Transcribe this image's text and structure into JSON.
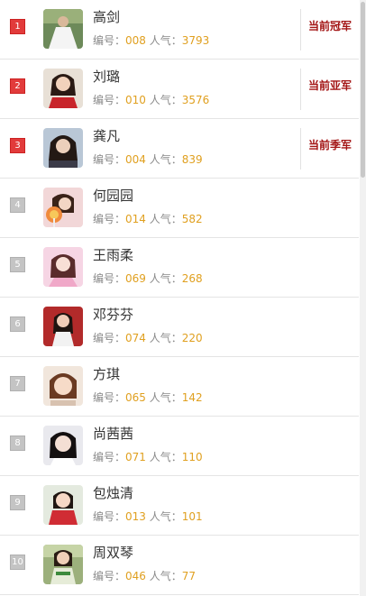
{
  "labels": {
    "id_prefix": "编号：",
    "pop_prefix": "人气："
  },
  "colors": {
    "accent_red": "#e23b3b",
    "badge_red": "#a31515",
    "value_gold": "#e0a020"
  },
  "items": [
    {
      "rank": "1",
      "name": "高剑",
      "id": "008",
      "popularity": "3793",
      "badge": "当前冠军",
      "avatar": "photo-woman-white-dress-outdoor"
    },
    {
      "rank": "2",
      "name": "刘璐",
      "id": "010",
      "popularity": "3576",
      "badge": "当前亚军",
      "avatar": "photo-woman-red-top"
    },
    {
      "rank": "3",
      "name": "龚凡",
      "id": "004",
      "popularity": "839",
      "badge": "当前季军",
      "avatar": "photo-woman-dark-hair"
    },
    {
      "rank": "4",
      "name": "何园园",
      "id": "014",
      "popularity": "582",
      "badge": "",
      "avatar": "photo-woman-lollipop"
    },
    {
      "rank": "5",
      "name": "王雨柔",
      "id": "069",
      "popularity": "268",
      "badge": "",
      "avatar": "photo-woman-pink"
    },
    {
      "rank": "6",
      "name": "邓芬芬",
      "id": "074",
      "popularity": "220",
      "badge": "",
      "avatar": "photo-woman-red-background"
    },
    {
      "rank": "7",
      "name": "方琪",
      "id": "065",
      "popularity": "142",
      "badge": "",
      "avatar": "photo-woman-short-hair"
    },
    {
      "rank": "8",
      "name": "尚茜茜",
      "id": "071",
      "popularity": "110",
      "badge": "",
      "avatar": "photo-woman-white-top"
    },
    {
      "rank": "9",
      "name": "包烛清",
      "id": "013",
      "popularity": "101",
      "badge": "",
      "avatar": "photo-woman-red-dress"
    },
    {
      "rank": "10",
      "name": "周双琴",
      "id": "046",
      "popularity": "77",
      "badge": "",
      "avatar": "photo-woman-outdoor-trees"
    }
  ]
}
